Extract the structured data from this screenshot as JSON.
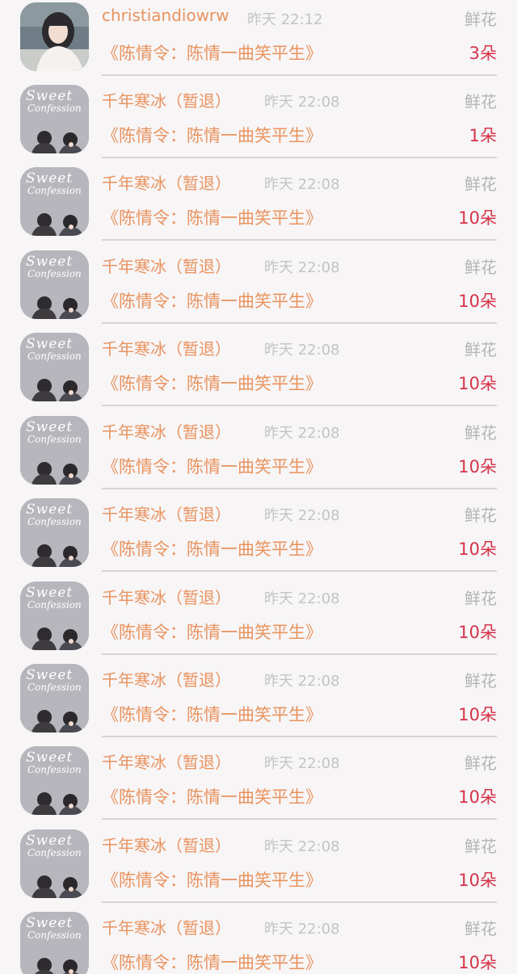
{
  "gift_list": [
    {
      "user": "christiandiowrw",
      "time": "昨天 22:12",
      "gift_type": "鲜花",
      "work": "《陈情令：陈情一曲笑平生》",
      "count": "3朵",
      "avatar_icon": "girl-photo-avatar"
    },
    {
      "user": "千年寒冰（暂退）",
      "time": "昨天 22:08",
      "gift_type": "鲜花",
      "work": "《陈情令：陈情一曲笑平生》",
      "count": "1朵",
      "avatar_icon": "sweet-confession-avatar",
      "avatar_text_1": "Sweet",
      "avatar_text_2": "Confession"
    },
    {
      "user": "千年寒冰（暂退）",
      "time": "昨天 22:08",
      "gift_type": "鲜花",
      "work": "《陈情令：陈情一曲笑平生》",
      "count": "10朵",
      "avatar_icon": "sweet-confession-avatar",
      "avatar_text_1": "Sweet",
      "avatar_text_2": "Confession"
    },
    {
      "user": "千年寒冰（暂退）",
      "time": "昨天 22:08",
      "gift_type": "鲜花",
      "work": "《陈情令：陈情一曲笑平生》",
      "count": "10朵",
      "avatar_icon": "sweet-confession-avatar",
      "avatar_text_1": "Sweet",
      "avatar_text_2": "Confession"
    },
    {
      "user": "千年寒冰（暂退）",
      "time": "昨天 22:08",
      "gift_type": "鲜花",
      "work": "《陈情令：陈情一曲笑平生》",
      "count": "10朵",
      "avatar_icon": "sweet-confession-avatar",
      "avatar_text_1": "Sweet",
      "avatar_text_2": "Confession"
    },
    {
      "user": "千年寒冰（暂退）",
      "time": "昨天 22:08",
      "gift_type": "鲜花",
      "work": "《陈情令：陈情一曲笑平生》",
      "count": "10朵",
      "avatar_icon": "sweet-confession-avatar",
      "avatar_text_1": "Sweet",
      "avatar_text_2": "Confession"
    },
    {
      "user": "千年寒冰（暂退）",
      "time": "昨天 22:08",
      "gift_type": "鲜花",
      "work": "《陈情令：陈情一曲笑平生》",
      "count": "10朵",
      "avatar_icon": "sweet-confession-avatar",
      "avatar_text_1": "Sweet",
      "avatar_text_2": "Confession"
    },
    {
      "user": "千年寒冰（暂退）",
      "time": "昨天 22:08",
      "gift_type": "鲜花",
      "work": "《陈情令：陈情一曲笑平生》",
      "count": "10朵",
      "avatar_icon": "sweet-confession-avatar",
      "avatar_text_1": "Sweet",
      "avatar_text_2": "Confession"
    },
    {
      "user": "千年寒冰（暂退）",
      "time": "昨天 22:08",
      "gift_type": "鲜花",
      "work": "《陈情令：陈情一曲笑平生》",
      "count": "10朵",
      "avatar_icon": "sweet-confession-avatar",
      "avatar_text_1": "Sweet",
      "avatar_text_2": "Confession"
    },
    {
      "user": "千年寒冰（暂退）",
      "time": "昨天 22:08",
      "gift_type": "鲜花",
      "work": "《陈情令：陈情一曲笑平生》",
      "count": "10朵",
      "avatar_icon": "sweet-confession-avatar",
      "avatar_text_1": "Sweet",
      "avatar_text_2": "Confession"
    },
    {
      "user": "千年寒冰（暂退）",
      "time": "昨天 22:08",
      "gift_type": "鲜花",
      "work": "《陈情令：陈情一曲笑平生》",
      "count": "10朵",
      "avatar_icon": "sweet-confession-avatar",
      "avatar_text_1": "Sweet",
      "avatar_text_2": "Confession"
    },
    {
      "user": "千年寒冰（暂退）",
      "time": "昨天 22:08",
      "gift_type": "鲜花",
      "work": "《陈情令：陈情一曲笑平生》",
      "count": "10朵",
      "avatar_icon": "sweet-confession-avatar",
      "avatar_text_1": "Sweet",
      "avatar_text_2": "Confession"
    }
  ],
  "colors": {
    "background": "#f7f5f6",
    "name_and_work": "#e9935f",
    "timestamp": "#c4c4c4",
    "gift_type": "#b4b4b4",
    "count": "#d6334a",
    "divider": "#d5d3d4"
  }
}
